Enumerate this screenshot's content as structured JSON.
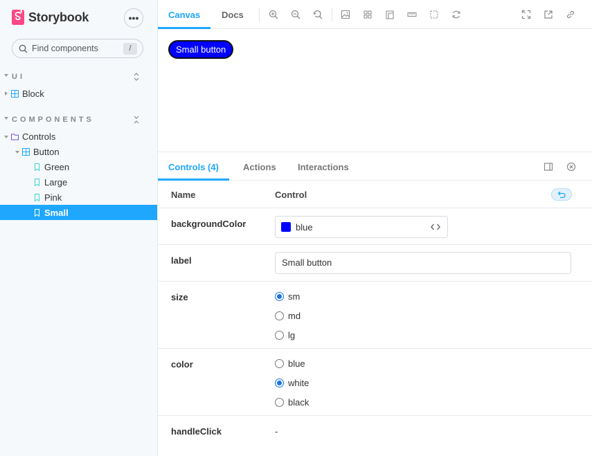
{
  "sidebar": {
    "brand": "Storybook",
    "menu_label": "•••",
    "search": {
      "placeholder": "Find components",
      "shortcut": "/"
    },
    "sections": [
      {
        "label": "UI",
        "tool_icon": "expand-icon"
      },
      {
        "label": "COMPONENTS",
        "tool_icon": "collapse-icon"
      }
    ],
    "tree": {
      "block": "Block",
      "controls": "Controls",
      "button": "Button",
      "stories": [
        "Green",
        "Large",
        "Pink",
        "Small"
      ]
    },
    "selected_story": "Small"
  },
  "toolbar": {
    "tabs": [
      "Canvas",
      "Docs"
    ],
    "active_tab": "Canvas",
    "icons": [
      "zoom-in-icon",
      "zoom-out-icon",
      "zoom-reset-icon",
      "background-icon",
      "grid-icon",
      "viewport-icon",
      "measure-icon",
      "outline-icon",
      "remount-icon",
      "fullscreen-icon",
      "open-new-tab-icon",
      "copy-link-icon"
    ]
  },
  "preview": {
    "button_label": "Small button"
  },
  "addons": {
    "tabs": [
      "Controls (4)",
      "Actions",
      "Interactions"
    ],
    "active_tab": "Controls (4)"
  },
  "controls": {
    "header": {
      "name": "Name",
      "control": "Control"
    },
    "backgroundColor": {
      "name": "backgroundColor",
      "value": "blue",
      "swatch": "#0000ff"
    },
    "label": {
      "name": "label",
      "value": "Small button"
    },
    "size": {
      "name": "size",
      "options": [
        "sm",
        "md",
        "lg"
      ],
      "selected": "sm"
    },
    "color": {
      "name": "color",
      "options": [
        "blue",
        "white",
        "black"
      ],
      "selected": "white"
    },
    "handleClick": {
      "name": "handleClick",
      "value": "-"
    }
  },
  "colors": {
    "accent": "#1ea7fd",
    "brand": "#ff4785"
  }
}
